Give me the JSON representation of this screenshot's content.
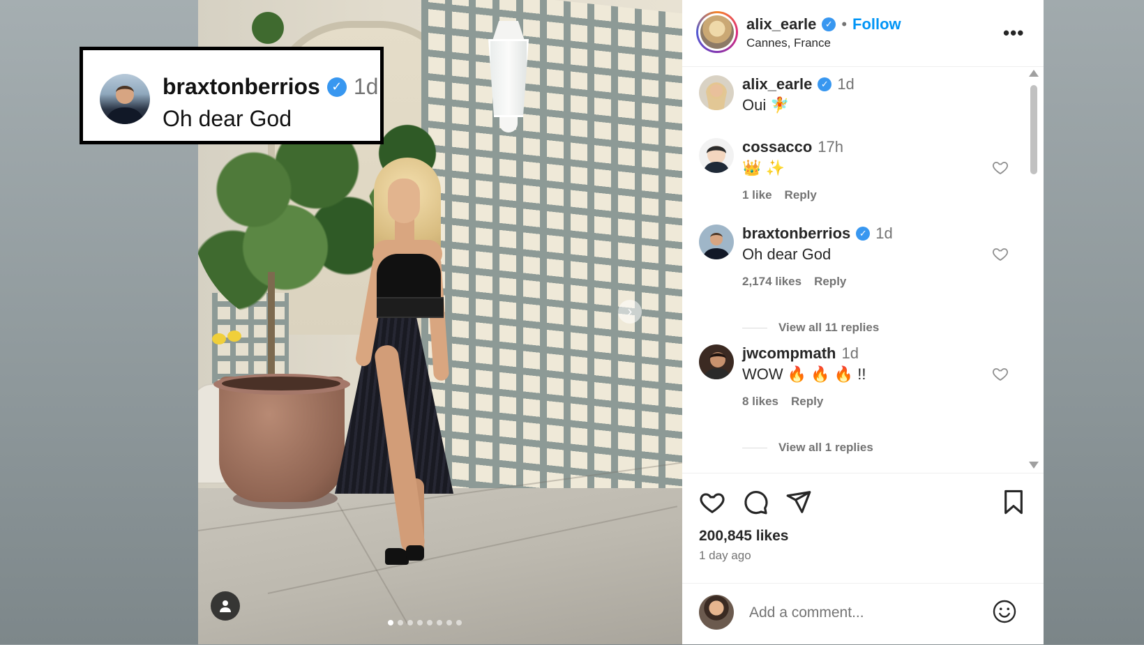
{
  "overlay": {
    "username": "braxtonberrios",
    "time": "1d",
    "text": "Oh dear God"
  },
  "post": {
    "author": "alix_earle",
    "follow_label": "Follow",
    "separator": "•",
    "location": "Cannes, France",
    "more_label": "•••",
    "likes": "200,845 likes",
    "posted_ago": "1 day ago",
    "carousel_dots": 8,
    "carousel_active": 0
  },
  "comments": [
    {
      "username": "alix_earle",
      "verified": true,
      "time": "1d",
      "text": "Oui 🧚",
      "likes": "",
      "reply": "",
      "heart": false
    },
    {
      "username": "cossacco",
      "verified": false,
      "time": "17h",
      "text": "👑 ✨",
      "likes": "1 like",
      "reply": "Reply",
      "heart": true
    },
    {
      "username": "braxtonberrios",
      "verified": true,
      "time": "1d",
      "text": "Oh dear God",
      "likes": "2,174 likes",
      "reply": "Reply",
      "heart": true,
      "view_all": "View all 11 replies"
    },
    {
      "username": "jwcompmath",
      "verified": false,
      "time": "1d",
      "text": "WOW 🔥 🔥 🔥 !!",
      "likes": "8 likes",
      "reply": "Reply",
      "heart": true,
      "view_all": "View all 1 replies"
    }
  ],
  "add_comment": {
    "placeholder": "Add a comment..."
  },
  "icons": {
    "like": "heart-icon",
    "comment": "comment-icon",
    "share": "share-icon",
    "save": "bookmark-icon",
    "emoji": "emoji-icon",
    "verified": "verified-badge-icon",
    "next": "chevron-right-icon",
    "tag": "user-tag-icon"
  },
  "colors": {
    "link_blue": "#0095f6",
    "verified_blue": "#3897f0",
    "muted": "#737373"
  }
}
